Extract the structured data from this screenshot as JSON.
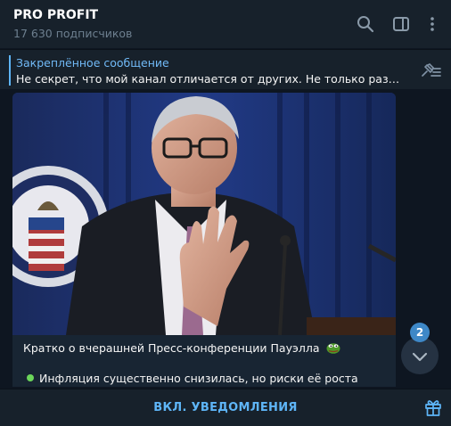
{
  "header": {
    "title": "PRO PROFIT",
    "subscribers": "17 630 подписчиков",
    "icons": [
      "search-icon",
      "sidebar-toggle-icon",
      "more-vertical-icon"
    ]
  },
  "pinned": {
    "title": "Закреплённое сообщение",
    "text": "Не секрет, что мой канал отличается от других.   Не только разбавляю",
    "icon": "pinned-list-icon"
  },
  "message": {
    "photo_icon": "press-conference-photo",
    "caption_title": "Кратко о вчерашней Пресс-конференции Пауэлла",
    "bullet": "Инфляция существенно снизилась, но риски её роста"
  },
  "scroll": {
    "unread_count": "2",
    "icon": "chevron-down-icon"
  },
  "footer": {
    "notify_label": "ВКЛ. УВЕДОМЛЕНИЯ",
    "gift_icon": "gift-icon"
  },
  "colors": {
    "background": "#0e1621",
    "panel": "#17212b",
    "bubble": "#182533",
    "accent": "#5eb5f7",
    "badge": "#3e88c7"
  }
}
